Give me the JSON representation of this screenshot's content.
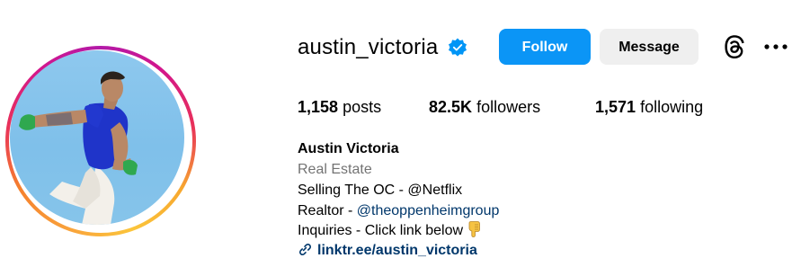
{
  "profile": {
    "username": "austin_victoria",
    "verified": true,
    "full_name": "Austin Victoria",
    "category": "Real Estate"
  },
  "actions": {
    "follow_label": "Follow",
    "message_label": "Message"
  },
  "stats": {
    "posts_count": "1,158",
    "posts_label": "posts",
    "followers_count": "82.5K",
    "followers_label": "followers",
    "following_count": "1,571",
    "following_label": "following"
  },
  "bio": {
    "line1": "Selling The OC - @Netflix",
    "line2_prefix": "Realtor - ",
    "line2_mention": "@theoppenheimgroup",
    "line3": "Inquiries - Click link below"
  },
  "link": {
    "text": "linktr.ee/austin_victoria"
  },
  "icons": {
    "verified": "verified-badge-icon",
    "threads": "threads-icon",
    "more": "more-options-icon",
    "link": "link-icon",
    "emoji": "pointing-down-emoji"
  },
  "colors": {
    "follow_button": "#0b95f6",
    "verified_badge": "#0095f6",
    "link_text": "#00376b",
    "category_text": "#737373"
  }
}
